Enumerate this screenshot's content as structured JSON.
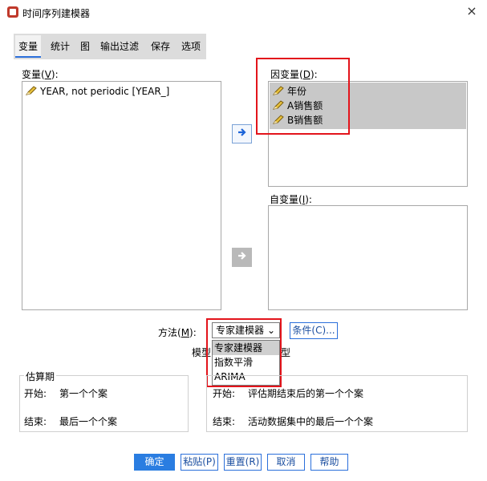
{
  "window": {
    "title": "时间序列建模器",
    "close_glyph": "×"
  },
  "tabs": [
    {
      "label": "变量"
    },
    {
      "label": "统计"
    },
    {
      "label": "图"
    },
    {
      "label": "输出过滤"
    },
    {
      "label": "保存"
    },
    {
      "label": "选项"
    }
  ],
  "variables": {
    "label_pre": "变量(",
    "label_key": "V",
    "label_post": "):",
    "items": [
      {
        "text": "YEAR, not periodic [YEAR_]"
      }
    ]
  },
  "dependent": {
    "label_pre": "因变量(",
    "label_key": "D",
    "label_post": "):",
    "items": [
      {
        "text": "年份"
      },
      {
        "text": "A销售额"
      },
      {
        "text": "B销售额"
      }
    ]
  },
  "independent": {
    "label_pre": "自变量(",
    "label_key": "I",
    "label_post": "):"
  },
  "method": {
    "label_pre": "方法(",
    "label_key": "M",
    "label_post": "):",
    "selected": "专家建模器",
    "options": [
      {
        "text": "专家建模器"
      },
      {
        "text": "指数平滑"
      },
      {
        "text": "ARIMA"
      }
    ],
    "criteria_label": "条件(C)...",
    "model_type_partial_left": "模型",
    "model_type_partial_right": "型"
  },
  "estimation": {
    "legend": "估算期",
    "start_label": "开始:",
    "start_value": "第一个个案",
    "end_label": "结束:",
    "end_value": "最后一个个案"
  },
  "forecast": {
    "start_label": "开始:",
    "start_value": "评估期结束后的第一个个案",
    "end_label": "结束:",
    "end_value": "活动数据集中的最后一个个案"
  },
  "buttons": {
    "ok": "确定",
    "paste": "粘贴(P)",
    "reset": "重置(R)",
    "cancel": "取消",
    "help": "帮助"
  }
}
